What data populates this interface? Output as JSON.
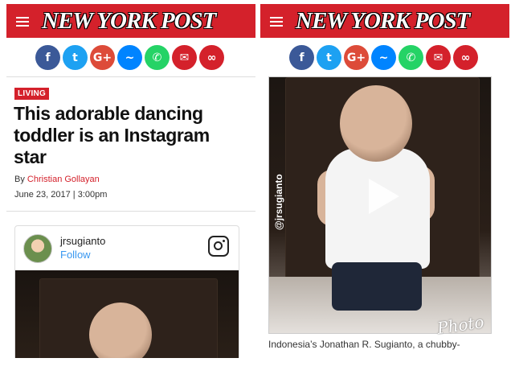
{
  "header": {
    "logo_text": "NEW YORK POST",
    "brand_color": "#d4212b"
  },
  "share_icons": [
    {
      "name": "facebook-icon",
      "glyph": "f",
      "color": "#3b5998"
    },
    {
      "name": "twitter-icon",
      "glyph": "t",
      "color": "#1da1f2"
    },
    {
      "name": "google-plus-icon",
      "glyph": "G+",
      "color": "#dd4b39"
    },
    {
      "name": "messenger-icon",
      "glyph": "~",
      "color": "#0084ff"
    },
    {
      "name": "whatsapp-icon",
      "glyph": "✆",
      "color": "#25d366"
    },
    {
      "name": "email-icon",
      "glyph": "✉",
      "color": "#d4212b"
    },
    {
      "name": "link-icon",
      "glyph": "∞",
      "color": "#d4212b"
    }
  ],
  "article": {
    "section_label": "LIVING",
    "headline": "This adorable dancing toddler is an Instagram star",
    "by_prefix": "By ",
    "author": "Christian Gollayan",
    "date": "June 23, 2017 | 3:00pm"
  },
  "instagram_embed": {
    "username": "jrsugianto",
    "follow_label": "Follow"
  },
  "video": {
    "watermark": "@jrsugianto",
    "caption": "Indonesia’s Jonathan R. Sugianto, a chubby-",
    "photo_mark": "Photo"
  }
}
